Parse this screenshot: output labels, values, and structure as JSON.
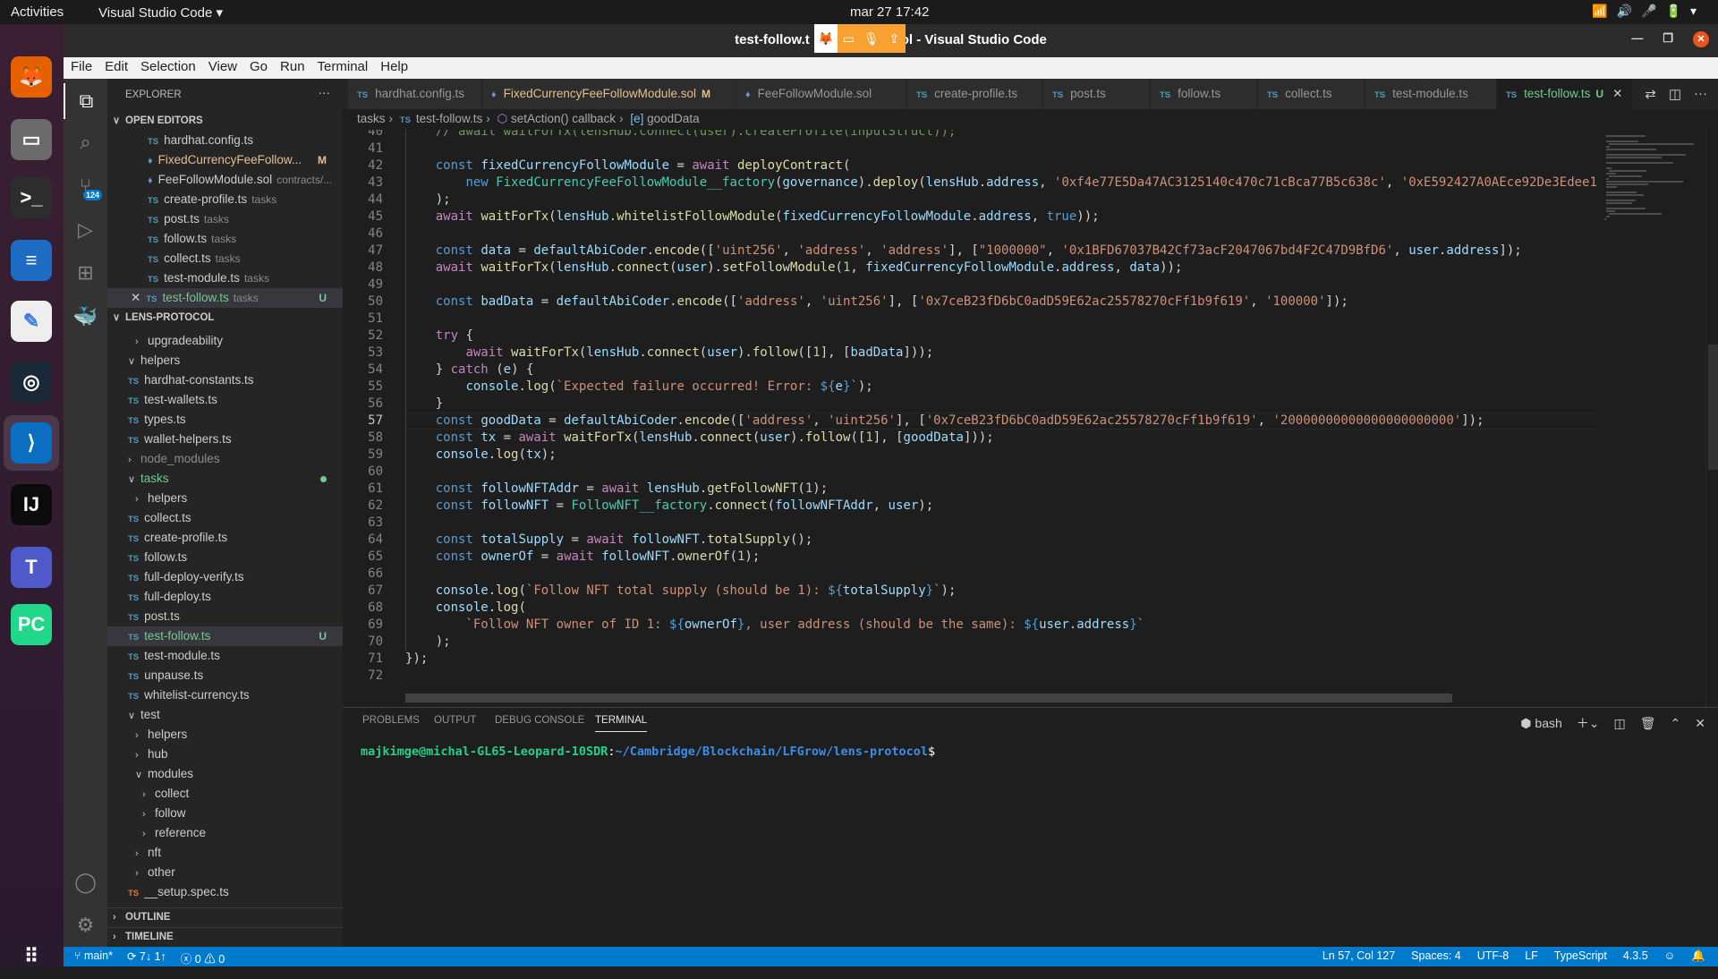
{
  "topbar": {
    "activities": "Activities",
    "app": "Visual Studio Code ▾",
    "clock": "mar 27  17:42",
    "tray": "wifi-icon volume-icon mic-icon battery-icon"
  },
  "window": {
    "title": "test-follow.ts - lens-protocol - Visual Studio Code",
    "title_left": "test-follow.t",
    "title_right": "ol - Visual Studio Code"
  },
  "dock": {
    "items": [
      {
        "name": "firefox",
        "glyph": "🦊",
        "bg": "#e66000"
      },
      {
        "name": "files",
        "glyph": "▭",
        "bg": "#6b6b6b"
      },
      {
        "name": "terminal",
        "glyph": ">_",
        "bg": "#2d2d2d"
      },
      {
        "name": "libreoffice-writer",
        "glyph": "≡",
        "bg": "#1e6bc4"
      },
      {
        "name": "text-editor",
        "glyph": "✎",
        "bg": "#eeeeee"
      },
      {
        "name": "steam",
        "glyph": "◎",
        "bg": "#1b2838"
      },
      {
        "name": "vscode",
        "glyph": "⟩",
        "bg": "#0a6fc2"
      },
      {
        "name": "intellij",
        "glyph": "IJ",
        "bg": "#0b0b0b"
      },
      {
        "name": "teams",
        "glyph": "T",
        "bg": "#5059c9"
      },
      {
        "name": "pycharm",
        "glyph": "PC",
        "bg": "#21d789"
      },
      {
        "name": "show-apps",
        "glyph": "⠿",
        "bg": "transparent"
      }
    ]
  },
  "menu": [
    "File",
    "Edit",
    "Selection",
    "View",
    "Go",
    "Run",
    "Terminal",
    "Help"
  ],
  "activity": {
    "scm_badge": "124"
  },
  "sidebar": {
    "title": "EXPLORER",
    "more": "···",
    "open_editors_label": "OPEN EDITORS",
    "open_editors": [
      {
        "icon": "ts",
        "label": "hardhat.config.ts",
        "desc": ""
      },
      {
        "icon": "sol",
        "label": "FixedCurrencyFeeFollow...",
        "desc": "",
        "status": "M",
        "color": "#e2c08d"
      },
      {
        "icon": "sol",
        "label": "FeeFollowModule.sol",
        "desc": "contracts/..."
      },
      {
        "icon": "ts",
        "label": "create-profile.ts",
        "desc": "tasks"
      },
      {
        "icon": "ts",
        "label": "post.ts",
        "desc": "tasks"
      },
      {
        "icon": "ts",
        "label": "follow.ts",
        "desc": "tasks"
      },
      {
        "icon": "ts",
        "label": "collect.ts",
        "desc": "tasks"
      },
      {
        "icon": "ts",
        "label": "test-module.ts",
        "desc": "tasks"
      },
      {
        "icon": "ts",
        "label": "test-follow.ts",
        "desc": "tasks",
        "status": "U",
        "color": "#73c991",
        "selected": true,
        "close": "✕"
      }
    ],
    "project_label": "LENS-PROTOCOL",
    "tree": [
      {
        "type": "folder",
        "open": false,
        "indent": 1,
        "label": "upgradeability"
      },
      {
        "type": "folder",
        "open": true,
        "indent": 0,
        "label": "helpers"
      },
      {
        "type": "file",
        "indent": 0,
        "label": "hardhat-constants.ts"
      },
      {
        "type": "file",
        "indent": 0,
        "label": "test-wallets.ts"
      },
      {
        "type": "file",
        "indent": 0,
        "label": "types.ts"
      },
      {
        "type": "file",
        "indent": 0,
        "label": "wallet-helpers.ts"
      },
      {
        "type": "folder",
        "open": false,
        "indent": 0,
        "label": "node_modules",
        "color": "#8b8b8b"
      },
      {
        "type": "folder",
        "open": true,
        "indent": 0,
        "label": "tasks",
        "color": "#73c991",
        "dot": true
      },
      {
        "type": "folder",
        "open": false,
        "indent": 1,
        "label": "helpers"
      },
      {
        "type": "file",
        "indent": 0,
        "label": "collect.ts"
      },
      {
        "type": "file",
        "indent": 0,
        "label": "create-profile.ts"
      },
      {
        "type": "file",
        "indent": 0,
        "label": "follow.ts"
      },
      {
        "type": "file",
        "indent": 0,
        "label": "full-deploy-verify.ts"
      },
      {
        "type": "file",
        "indent": 0,
        "label": "full-deploy.ts"
      },
      {
        "type": "file",
        "indent": 0,
        "label": "post.ts"
      },
      {
        "type": "file",
        "indent": 0,
        "label": "test-follow.ts",
        "status": "U",
        "color": "#73c991",
        "selected": true
      },
      {
        "type": "file",
        "indent": 0,
        "label": "test-module.ts"
      },
      {
        "type": "file",
        "indent": 0,
        "label": "unpause.ts"
      },
      {
        "type": "file",
        "indent": 0,
        "label": "whitelist-currency.ts"
      },
      {
        "type": "folder",
        "open": true,
        "indent": 0,
        "label": "test"
      },
      {
        "type": "folder",
        "open": false,
        "indent": 1,
        "label": "helpers"
      },
      {
        "type": "folder",
        "open": false,
        "indent": 1,
        "label": "hub"
      },
      {
        "type": "folder",
        "open": true,
        "indent": 1,
        "label": "modules"
      },
      {
        "type": "folder",
        "open": false,
        "indent": 2,
        "label": "collect"
      },
      {
        "type": "folder",
        "open": false,
        "indent": 2,
        "label": "follow"
      },
      {
        "type": "folder",
        "open": false,
        "indent": 2,
        "label": "reference"
      },
      {
        "type": "folder",
        "open": false,
        "indent": 1,
        "label": "nft"
      },
      {
        "type": "folder",
        "open": false,
        "indent": 1,
        "label": "other"
      },
      {
        "type": "file",
        "indent": 0,
        "label": "__setup.spec.ts",
        "color": "#cccccc"
      }
    ],
    "outline_label": "OUTLINE",
    "timeline_label": "TIMELINE"
  },
  "tabs": [
    {
      "icon": "TS",
      "label": "hardhat.config.ts"
    },
    {
      "icon": "♦",
      "label": "FixedCurrencyFeeFollowModule.sol",
      "status": "M",
      "color": "#e2c08d"
    },
    {
      "icon": "♦",
      "label": "FeeFollowModule.sol"
    },
    {
      "icon": "TS",
      "label": "create-profile.ts"
    },
    {
      "icon": "TS",
      "label": "post.ts"
    },
    {
      "icon": "TS",
      "label": "follow.ts"
    },
    {
      "icon": "TS",
      "label": "collect.ts"
    },
    {
      "icon": "TS",
      "label": "test-module.ts"
    },
    {
      "icon": "TS",
      "label": "test-follow.ts",
      "status": "U",
      "active": true,
      "close": "✕"
    }
  ],
  "breadcrumb": [
    "tasks",
    "test-follow.ts",
    "setAction() callback",
    "goodData"
  ],
  "editor": {
    "first_line": 40,
    "current_line": 57,
    "lines": [
      "    // await waitForTx(lensHub.connect(user).createProfile(inputStruct));",
      "",
      "    const fixedCurrencyFollowModule = await deployContract(",
      "        new FixedCurrencyFeeFollowModule__factory(governance).deploy(lensHub.address, '0xf4e77E5Da47AC3125140c470c71cBca77B5c638c', '0xE592427A0AEce92De3Edee1",
      "    );",
      "    await waitForTx(lensHub.whitelistFollowModule(fixedCurrencyFollowModule.address, true));",
      "",
      "    const data = defaultAbiCoder.encode(['uint256', 'address', 'address'], [\"1000000\", '0x1BFD67037B42Cf73acF2047067bd4F2C47D9BfD6', user.address]);",
      "    await waitForTx(lensHub.connect(user).setFollowModule(1, fixedCurrencyFollowModule.address, data));",
      "",
      "    const badData = defaultAbiCoder.encode(['address', 'uint256'], ['0x7ceB23fD6bC0adD59E62ac25578270cFf1b9f619', '100000']);",
      "",
      "    try {",
      "        await waitForTx(lensHub.connect(user).follow([1], [badData]));",
      "    } catch (e) {",
      "        console.log(`Expected failure occurred! Error: ${e}`);",
      "    }",
      "    const goodData = defaultAbiCoder.encode(['address', 'uint256'], ['0x7ceB23fD6bC0adD59E62ac25578270cFf1b9f619', '20000000000000000000000']);",
      "    const tx = await waitForTx(lensHub.connect(user).follow([1], [goodData]));",
      "    console.log(tx);",
      "",
      "    const followNFTAddr = await lensHub.getFollowNFT(1);",
      "    const followNFT = FollowNFT__factory.connect(followNFTAddr, user);",
      "",
      "    const totalSupply = await followNFT.totalSupply();",
      "    const ownerOf = await followNFT.ownerOf(1);",
      "",
      "    console.log(`Follow NFT total supply (should be 1): ${totalSupply}`);",
      "    console.log(",
      "        `Follow NFT owner of ID 1: ${ownerOf}, user address (should be the same): ${user.address}`",
      "    );",
      "});",
      ""
    ]
  },
  "panel": {
    "tabs": [
      "PROBLEMS",
      "OUTPUT",
      "DEBUG CONSOLE",
      "TERMINAL"
    ],
    "active_tab": "TERMINAL",
    "shell": "bash",
    "prompt_user": "majkimge@michal-GL65-Leopard-10SDR",
    "prompt_path": "~/Cambridge/Blockchain/LFGrow/lens-protocol",
    "prompt_symbol": "$"
  },
  "status": {
    "branch": "main*",
    "sync": "7↓ 1↑",
    "errors": "0",
    "warnings": "0",
    "position": "Ln 57, Col 127",
    "spaces": "Spaces: 4",
    "encoding": "UTF-8",
    "eol": "LF",
    "language": "TypeScript",
    "version": "4.3.5"
  },
  "colors": {
    "accent": "#007acc",
    "modified": "#e2c08d",
    "untracked": "#73c991",
    "ubuntu_orange": "#e9541f"
  }
}
